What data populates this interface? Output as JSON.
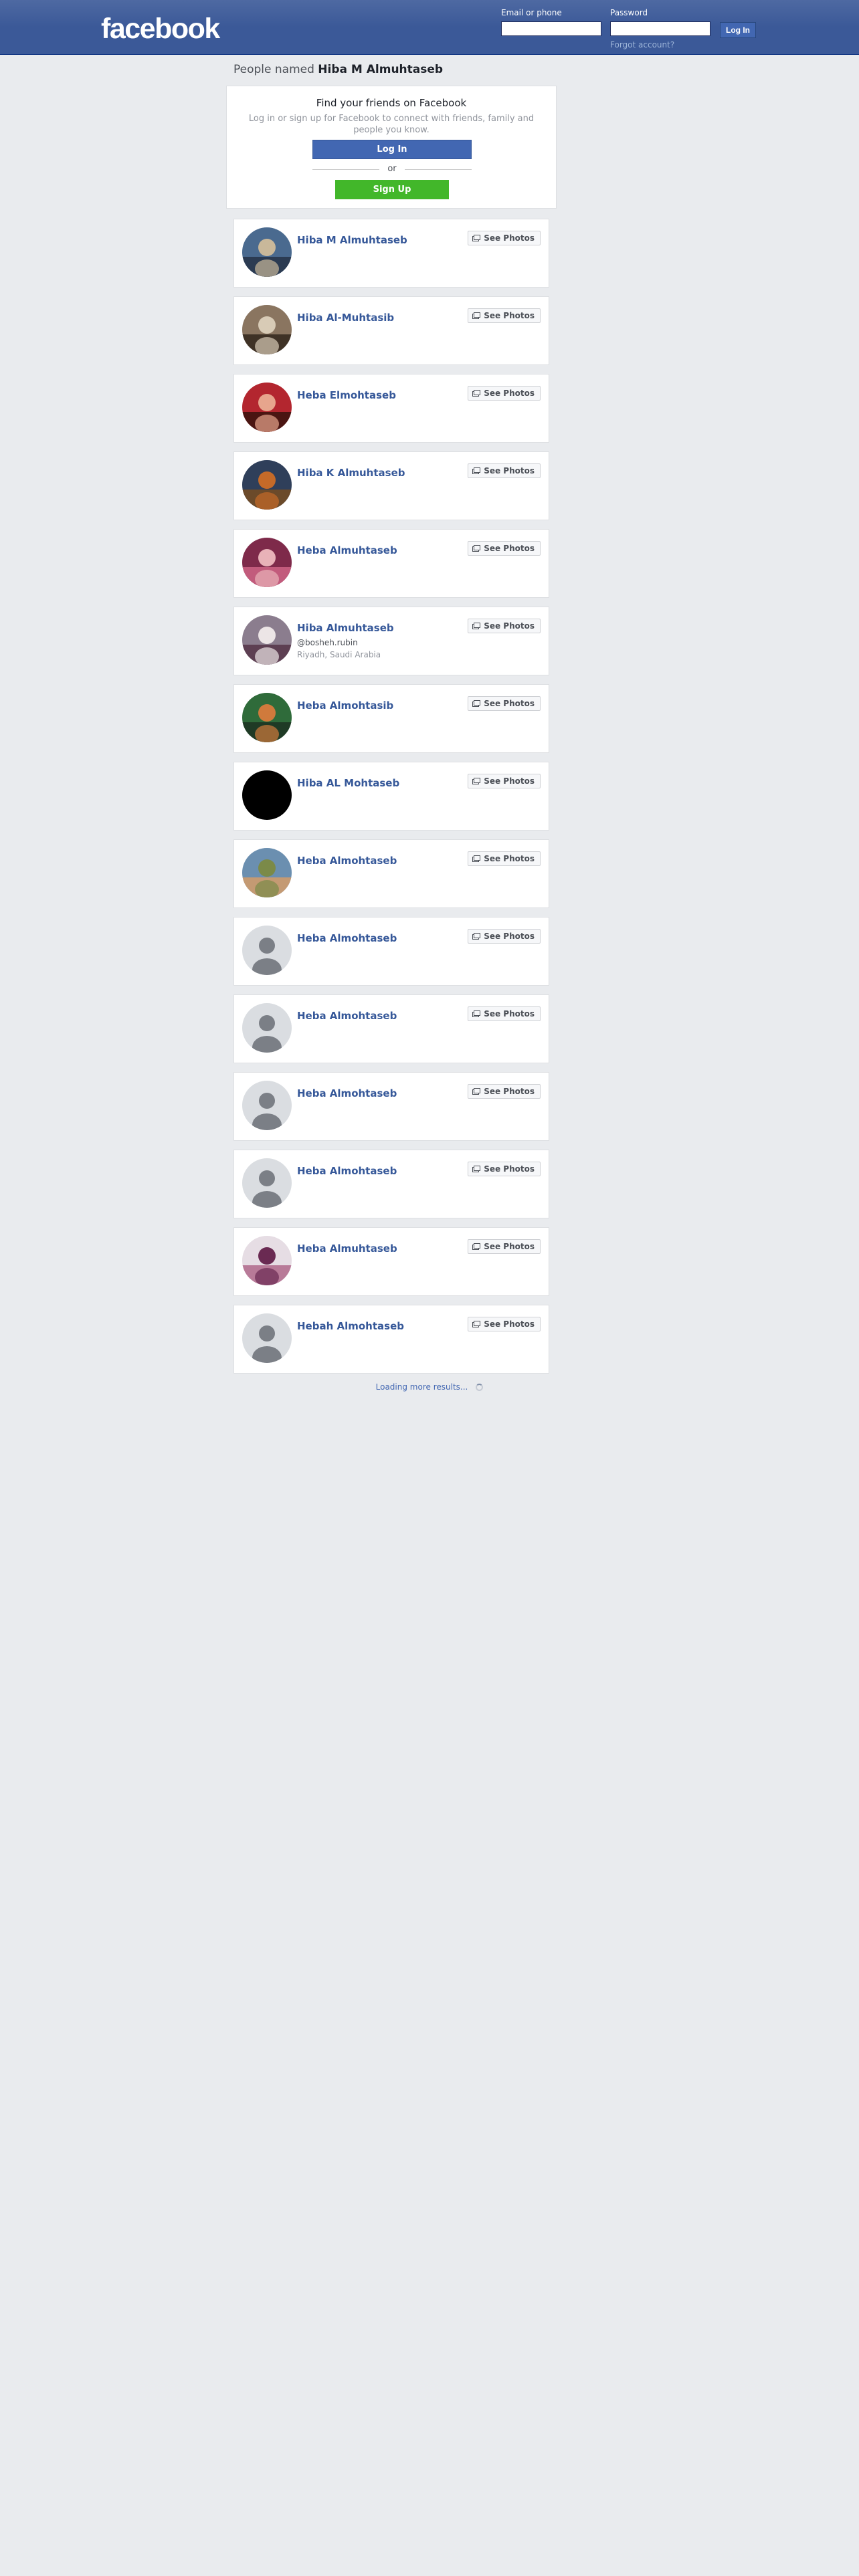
{
  "header": {
    "logo": "facebook",
    "email_label": "Email or phone",
    "password_label": "Password",
    "login_button": "Log In",
    "forgot_link": "Forgot account?"
  },
  "page": {
    "title_prefix": "People named ",
    "title_name": "Hiba M Almuhtaseb"
  },
  "find_friends": {
    "title": "Find your friends on Facebook",
    "subtitle": "Log in or sign up for Facebook to connect with friends, family and people you know.",
    "login_button": "Log In",
    "or_text": "or",
    "signup_button": "Sign Up"
  },
  "see_photos_label": "See Photos",
  "results": [
    {
      "name": "Hiba M Almuhtaseb",
      "avatar": "photo",
      "colors": [
        "#4a6a8f",
        "#c9b89a",
        "#2b3b52"
      ]
    },
    {
      "name": "Hiba Al-Muhtasib",
      "avatar": "photo",
      "colors": [
        "#8a7560",
        "#d8cbb6",
        "#3f3226"
      ]
    },
    {
      "name": "Heba Elmohtaseb",
      "avatar": "photo",
      "colors": [
        "#b3262f",
        "#e7a58d",
        "#4a1512"
      ]
    },
    {
      "name": "Hiba K Almuhtaseb",
      "avatar": "photo",
      "colors": [
        "#2f3f5a",
        "#c56a28",
        "#6b4a2a"
      ]
    },
    {
      "name": "Heba Almuhtaseb",
      "avatar": "photo",
      "colors": [
        "#7e2a4a",
        "#e8b2b8",
        "#c25b7c"
      ]
    },
    {
      "name": "Hiba Almuhtaseb",
      "handle": "@bosheh.rubin",
      "location": "Riyadh, Saudi Arabia",
      "avatar": "photo",
      "colors": [
        "#8b7d8e",
        "#ece5e6",
        "#5d3f52"
      ]
    },
    {
      "name": "Heba Almohtasib",
      "avatar": "photo",
      "colors": [
        "#2f6b3a",
        "#d07a3c",
        "#1f3a25"
      ]
    },
    {
      "name": "Hiba AL Mohtaseb",
      "avatar": "black",
      "colors": [
        "#000000",
        "#000000",
        "#000000"
      ]
    },
    {
      "name": "Heba Almohtaseb",
      "avatar": "photo",
      "colors": [
        "#6b8fb0",
        "#7b8a48",
        "#c49a73"
      ]
    },
    {
      "name": "Heba Almohtaseb",
      "avatar": "silhouette"
    },
    {
      "name": "Heba Almohtaseb",
      "avatar": "silhouette"
    },
    {
      "name": "Heba Almohtaseb",
      "avatar": "silhouette"
    },
    {
      "name": "Heba Almohtaseb",
      "avatar": "silhouette"
    },
    {
      "name": "Heba Almuhtaseb",
      "avatar": "photo",
      "colors": [
        "#e6dde4",
        "#6a2a52",
        "#b87a98"
      ]
    },
    {
      "name": "Hebah Almohtaseb",
      "avatar": "silhouette"
    }
  ],
  "loading_text": "Loading more results..."
}
